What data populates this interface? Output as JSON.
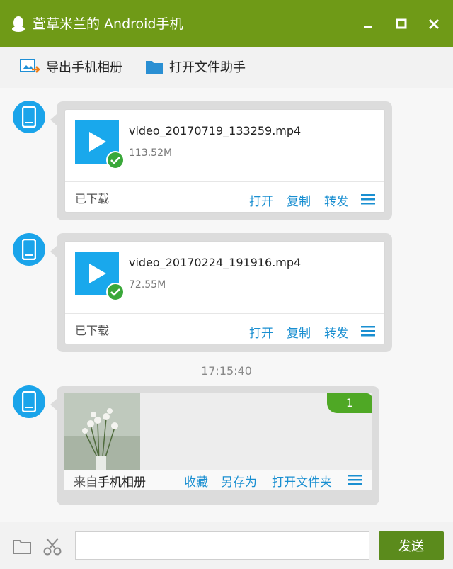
{
  "window": {
    "title": "萱草米兰的 Android手机",
    "controls": [
      "minimize-icon",
      "maximize-icon",
      "close-icon"
    ]
  },
  "toolbar": {
    "export_label": "导出手机相册",
    "assistant_label": "打开文件助手"
  },
  "messages": [
    {
      "type": "file",
      "filename": "video_20170719_133259.mp4",
      "size": "113.52M",
      "status": "已下载",
      "actions": [
        "打开",
        "复制",
        "转发"
      ]
    },
    {
      "type": "file",
      "filename": "video_20170224_191916.mp4",
      "size": "72.55M",
      "status": "已下载",
      "actions": [
        "打开",
        "复制",
        "转发"
      ]
    }
  ],
  "time_divider": "17:15:40",
  "image_message": {
    "count": "1",
    "from_prefix": "来自",
    "from_source": "手机相册",
    "actions": [
      "收藏",
      "另存为",
      "打开文件夹"
    ]
  },
  "input": {
    "value": "",
    "send_label": "发送"
  },
  "colors": {
    "title_bar": "#6f9a17",
    "accent_blue": "#1aa4ea",
    "link_blue": "#1a8fd1",
    "send_button": "#5b8b1c",
    "badge_green": "#4fa825"
  }
}
